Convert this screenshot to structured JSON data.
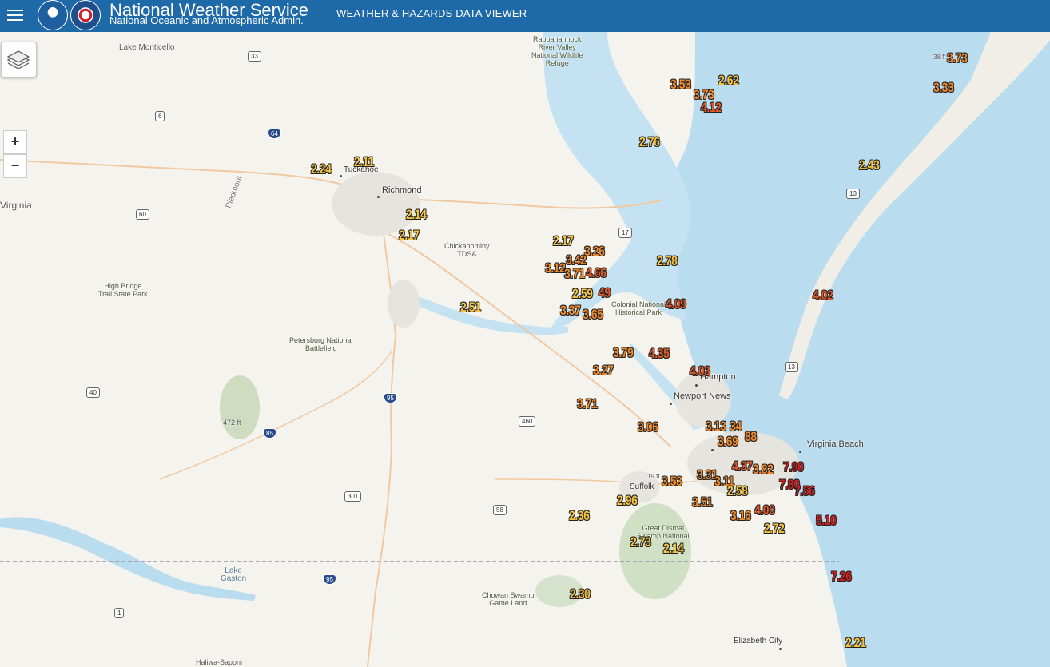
{
  "header": {
    "title": "National Weather Service",
    "subtitle": "National Oceanic and Atmospheric Admin.",
    "app_name": "WEATHER & HAZARDS DATA VIEWER"
  },
  "controls": {
    "zoom_in": "+",
    "zoom_out": "−"
  },
  "colors": {
    "low": "#f5c542",
    "mid": "#f08a2c",
    "high": "#e05a2a",
    "extreme": "#d42020"
  },
  "places": {
    "lake_monticello": "Lake Monticello",
    "rappahannock": "Rappahannock\nRiver Valley\nNational Wildlife\nRefuge",
    "tuckahoe": "Tuckahoe",
    "richmond": "Richmond",
    "virginia": "Virginia",
    "piedmont": "Piedmont",
    "chickahominy": "Chickahominy\nTDSA",
    "high_bridge": "High Bridge\nTrail State Park",
    "colonial": "Colonial National\nHistorical Park",
    "petersburg": "Petersburg National\nBattlefield",
    "hampton": "Hampton",
    "newport_news": "Newport News",
    "elev": "472 ft",
    "virginia_beach": "Virginia Beach",
    "suffolk": "Suffolk",
    "elev2": "19 ft",
    "great_dismal": "Great Dismal\nSwamp National",
    "lake_gaston": "Lake\nGaston",
    "chowan": "Chowan Swamp\nGame Land",
    "elizabeth_city": "Elizabeth City",
    "haliwa": "Haliwa-Saponi",
    "elev3": "38 ft"
  },
  "shields": {
    "s33": "33",
    "s6": "6",
    "s64": "64",
    "s60": "60",
    "s17": "17",
    "s13a": "13",
    "s13b": "13",
    "s40": "40",
    "s95": "95",
    "s460": "460",
    "s85": "85",
    "s301": "301",
    "s58": "58",
    "s95b": "95",
    "s1": "1"
  },
  "values": [
    {
      "t": "3.73",
      "c": "mid"
    },
    {
      "t": "3.33",
      "c": "mid"
    },
    {
      "t": "3.53",
      "c": "mid"
    },
    {
      "t": "2.62",
      "c": "low"
    },
    {
      "t": "3.73",
      "c": "mid"
    },
    {
      "t": "4.12",
      "c": "high"
    },
    {
      "t": "2.76",
      "c": "low"
    },
    {
      "t": "2.43",
      "c": "low"
    },
    {
      "t": "2.11",
      "c": "low"
    },
    {
      "t": "2.24",
      "c": "low"
    },
    {
      "t": "2.14",
      "c": "low"
    },
    {
      "t": "2.17",
      "c": "low"
    },
    {
      "t": "2.17",
      "c": "low"
    },
    {
      "t": "3.26",
      "c": "mid"
    },
    {
      "t": "2.78",
      "c": "low"
    },
    {
      "t": "3.12",
      "c": "mid"
    },
    {
      "t": "3.42",
      "c": "mid"
    },
    {
      "t": "3.71",
      "c": "mid"
    },
    {
      "t": "4.66",
      "c": "high"
    },
    {
      "t": "2.59",
      "c": "low"
    },
    {
      "t": "49",
      "c": "high"
    },
    {
      "t": "2.51",
      "c": "low"
    },
    {
      "t": "3.37",
      "c": "mid"
    },
    {
      "t": "3.65",
      "c": "mid"
    },
    {
      "t": "4.09",
      "c": "high"
    },
    {
      "t": "4.02",
      "c": "high"
    },
    {
      "t": "3.79",
      "c": "mid"
    },
    {
      "t": "4.35",
      "c": "high"
    },
    {
      "t": "3.27",
      "c": "mid"
    },
    {
      "t": "4.03",
      "c": "high"
    },
    {
      "t": "3.71",
      "c": "mid"
    },
    {
      "t": "3.06",
      "c": "mid"
    },
    {
      "t": "3.13",
      "c": "mid"
    },
    {
      "t": "34",
      "c": "mid"
    },
    {
      "t": "3.69",
      "c": "mid"
    },
    {
      "t": "88",
      "c": "mid"
    },
    {
      "t": "4.37",
      "c": "high"
    },
    {
      "t": "3.82",
      "c": "mid"
    },
    {
      "t": "7.90",
      "c": "extreme"
    },
    {
      "t": "3.31",
      "c": "mid"
    },
    {
      "t": "3.11",
      "c": "mid"
    },
    {
      "t": "7.80",
      "c": "extreme"
    },
    {
      "t": "7.56",
      "c": "extreme"
    },
    {
      "t": "3.53",
      "c": "mid"
    },
    {
      "t": "2.58",
      "c": "low"
    },
    {
      "t": "2.96",
      "c": "low"
    },
    {
      "t": "3.51",
      "c": "mid"
    },
    {
      "t": "2.36",
      "c": "low"
    },
    {
      "t": "3.16",
      "c": "mid"
    },
    {
      "t": "4.00",
      "c": "high"
    },
    {
      "t": "5.10",
      "c": "extreme"
    },
    {
      "t": "2.72",
      "c": "low"
    },
    {
      "t": "2.73",
      "c": "low"
    },
    {
      "t": "2.14",
      "c": "low"
    },
    {
      "t": "7.26",
      "c": "extreme"
    },
    {
      "t": "2.30",
      "c": "low"
    },
    {
      "t": "2.21",
      "c": "low"
    }
  ]
}
